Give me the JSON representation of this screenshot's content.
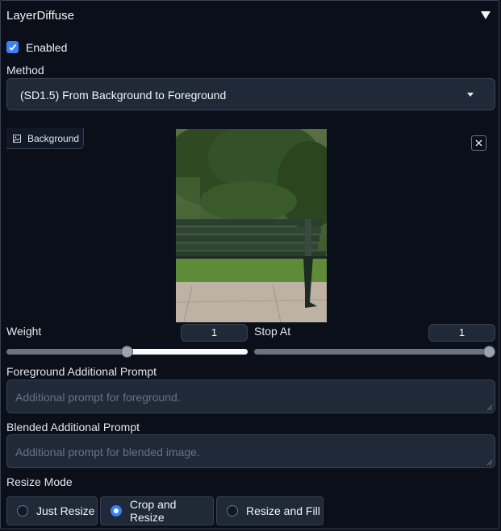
{
  "header": {
    "title": "LayerDiffuse"
  },
  "enabled": {
    "label": "Enabled",
    "checked": true
  },
  "method": {
    "label": "Method",
    "value": "(SD1.5) From Background to Foreground"
  },
  "background_image": {
    "label": "Background"
  },
  "weight": {
    "label": "Weight",
    "value": "1",
    "slider_fraction": 0.5
  },
  "stop_at": {
    "label": "Stop At",
    "value": "1",
    "slider_fraction": 1.0
  },
  "foreground_prompt": {
    "label": "Foreground Additional Prompt",
    "placeholder": "Additional prompt for foreground."
  },
  "blended_prompt": {
    "label": "Blended Additional Prompt",
    "placeholder": "Additional prompt for blended image."
  },
  "resize_mode": {
    "label": "Resize Mode",
    "options": [
      "Just Resize",
      "Crop and Resize",
      "Resize and Fill"
    ],
    "selected": "Crop and Resize"
  },
  "colors": {
    "accent": "#3b82f6",
    "background": "#0b0f19",
    "input": "#1f2937"
  }
}
